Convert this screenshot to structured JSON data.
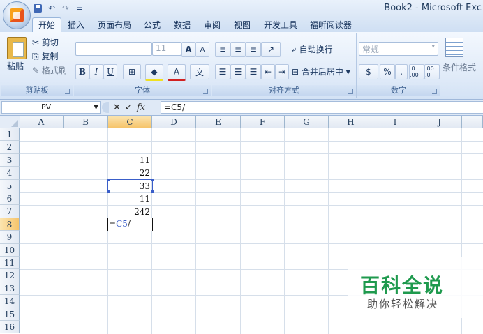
{
  "window": {
    "title": "Book2 - Microsoft Exc"
  },
  "quick_access": {
    "undo": "↶",
    "redo": "↷",
    "customize": "="
  },
  "tabs": [
    "开始",
    "插入",
    "页面布局",
    "公式",
    "数据",
    "审阅",
    "视图",
    "开发工具",
    "福昕阅读器"
  ],
  "ribbon": {
    "clipboard": {
      "paste": "粘贴",
      "cut": "剪切",
      "copy": "复制",
      "format_painter": "格式刷",
      "label": "剪贴板"
    },
    "font": {
      "size": "11",
      "bold": "B",
      "italic": "I",
      "underline": "U",
      "grow": "A",
      "shrink": "A",
      "label": "字体"
    },
    "alignment": {
      "wrap": "自动换行",
      "merge": "合并后居中",
      "label": "对齐方式"
    },
    "number": {
      "format": "常规",
      "percent": "%",
      "comma": ",",
      "inc_dec": ".0 .00",
      "dec_dec": ".00 .0",
      "label": "数字"
    },
    "styles": {
      "conditional": "条件格式"
    }
  },
  "formula_bar": {
    "name_box": "PV",
    "cancel": "✕",
    "confirm": "✓",
    "fx": "fx",
    "formula": "=C5/"
  },
  "columns": [
    "A",
    "B",
    "C",
    "D",
    "E",
    "F",
    "G",
    "H",
    "I",
    "J"
  ],
  "rows": [
    "1",
    "2",
    "3",
    "4",
    "5",
    "6",
    "7",
    "8",
    "9",
    "10",
    "11",
    "12",
    "13",
    "14",
    "15",
    "16"
  ],
  "cells": {
    "C3": "11",
    "C4": "22",
    "C5": "33",
    "C6": "11",
    "C7": "242",
    "C8_prefix": "=",
    "C8_ref": "C5",
    "C8_suffix": "/"
  },
  "watermark": {
    "title": "百科全说",
    "subtitle": "助你轻松解决"
  }
}
